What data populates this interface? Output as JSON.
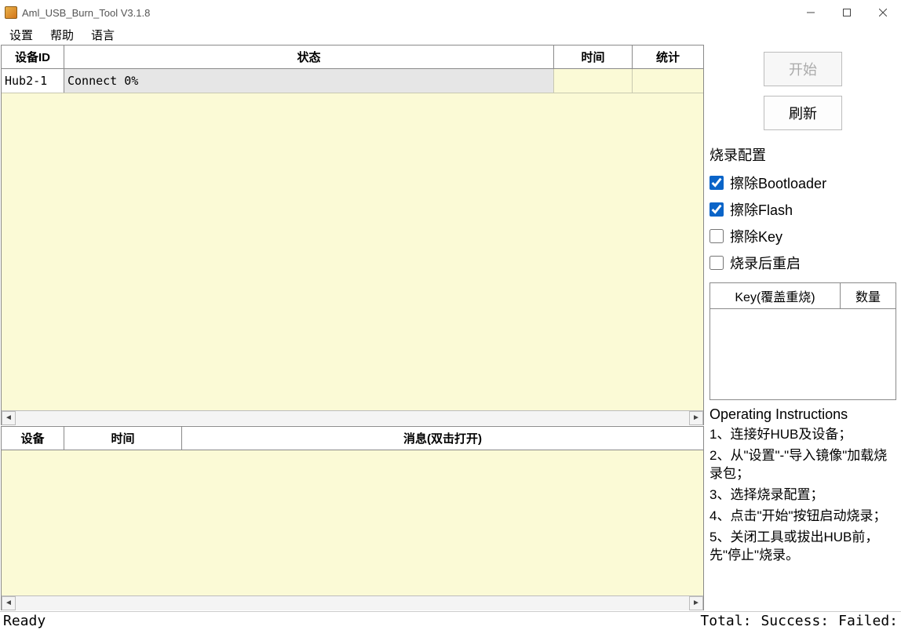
{
  "window": {
    "title": "Aml_USB_Burn_Tool V3.1.8"
  },
  "menu": {
    "settings": "设置",
    "help": "帮助",
    "language": "语言"
  },
  "top_table": {
    "headers": {
      "id": "设备ID",
      "state": "状态",
      "time": "时间",
      "stat": "统计"
    },
    "rows": [
      {
        "id": "Hub2-1",
        "state": "Connect 0%",
        "time": "",
        "stat": ""
      }
    ]
  },
  "bot_table": {
    "headers": {
      "device": "设备",
      "time": "时间",
      "message": "消息(双击打开)"
    }
  },
  "panel": {
    "start": "开始",
    "refresh": "刷新",
    "config_title": "烧录配置",
    "checks": {
      "erase_bootloader": {
        "label": "擦除Bootloader",
        "checked": true
      },
      "erase_flash": {
        "label": "擦除Flash",
        "checked": true
      },
      "erase_key": {
        "label": "擦除Key",
        "checked": false
      },
      "reboot_after": {
        "label": "烧录后重启",
        "checked": false
      }
    },
    "key_table": {
      "col1": "Key(覆盖重烧)",
      "col2": "数量"
    },
    "instructions": {
      "title": "Operating Instructions",
      "l1": "1、连接好HUB及设备；",
      "l2": "2、从\"设置\"-\"导入镜像\"加载烧录包；",
      "l3": "3、选择烧录配置；",
      "l4": "4、点击\"开始\"按钮启动烧录；",
      "l5": "5、关闭工具或拔出HUB前，先\"停止\"烧录。"
    }
  },
  "status": {
    "ready": "Ready",
    "total": "Total:",
    "success": "Success:",
    "failed": "Failed:"
  }
}
